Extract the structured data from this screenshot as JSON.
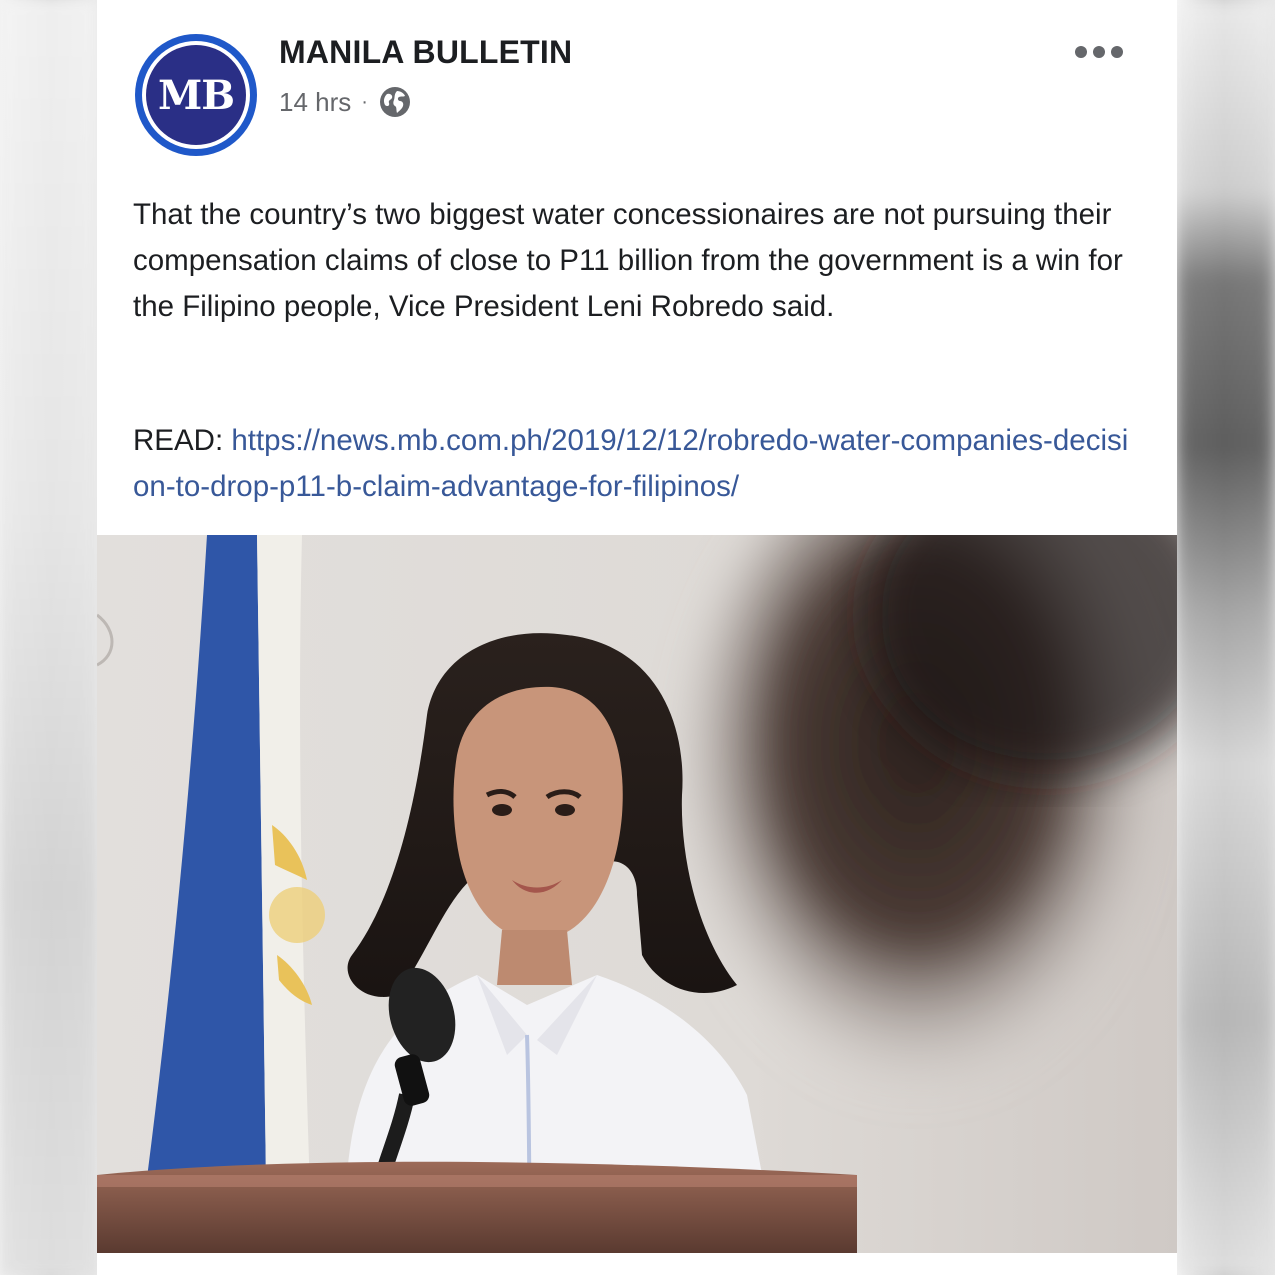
{
  "post": {
    "page_name": "MANILA BULLETIN",
    "avatar_text": "MB",
    "timestamp": "14 hrs",
    "separator": "·",
    "audience_icon": "globe-icon",
    "more_icon": "more-horizontal-icon",
    "body_text": "That the country’s two biggest water concessionaires are not pursuing their compensation claims of close to P11 billion from the government is a win for the Filipino people, Vice President Leni Robredo said.",
    "read_label": "READ:",
    "read_link": "https://news.mb.com.ph/2019/12/12/robredo-water-companies-decision-to-drop-p11-b-claim-advantage-for-filipinos/"
  },
  "colors": {
    "text": "#1c1e21",
    "meta": "#65676b",
    "link": "#385898",
    "avatar_ring": "#1f58c9",
    "avatar_core": "#2a2f86"
  }
}
